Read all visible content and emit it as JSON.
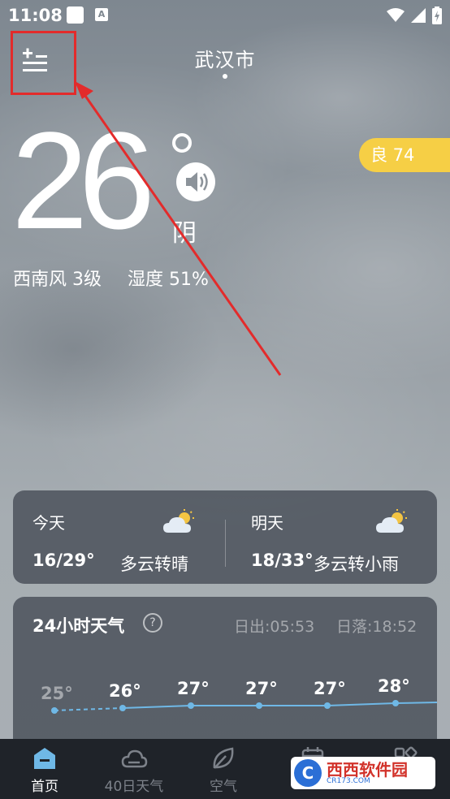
{
  "status_bar": {
    "time": "11:08",
    "notification_icon": "A"
  },
  "header": {
    "city": "武汉市"
  },
  "current": {
    "temperature": "26",
    "condition": "阴",
    "wind": "西南风 3级",
    "humidity": "湿度 51%",
    "aqi_label": "良 74"
  },
  "forecast": {
    "today": {
      "label": "今天",
      "temps": "16/29°",
      "desc": "多云转晴"
    },
    "tomorrow": {
      "label": "明天",
      "temps": "18/33°",
      "desc": "多云转小雨"
    }
  },
  "hourly": {
    "title": "24小时天气",
    "help": "?",
    "sunrise": "日出:05:53",
    "sunset": "日落:18:52"
  },
  "chart_data": {
    "type": "line",
    "values": [
      25,
      26,
      27,
      27,
      27,
      28
    ],
    "labels": [
      "25°",
      "26°",
      "27°",
      "27°",
      "27°",
      "28°"
    ]
  },
  "nav": {
    "items": [
      {
        "label": "首页",
        "icon": "home-icon",
        "active": true
      },
      {
        "label": "40日天气",
        "icon": "cloud-icon",
        "active": false
      },
      {
        "label": "空气",
        "icon": "leaf-icon",
        "active": false
      },
      {
        "label": "",
        "icon": "calendar-icon",
        "active": false
      },
      {
        "label": "",
        "icon": "grid-icon",
        "active": false
      }
    ]
  },
  "watermark": {
    "logo": "C",
    "main": "西西软件园",
    "sub": "CR173.COM"
  },
  "colors": {
    "aqi_badge": "#f6cf45",
    "card": "#484e58",
    "chart_line": "#6fb8e6",
    "annotation": "#e32b2b",
    "nav_bg": "#1f2329"
  }
}
